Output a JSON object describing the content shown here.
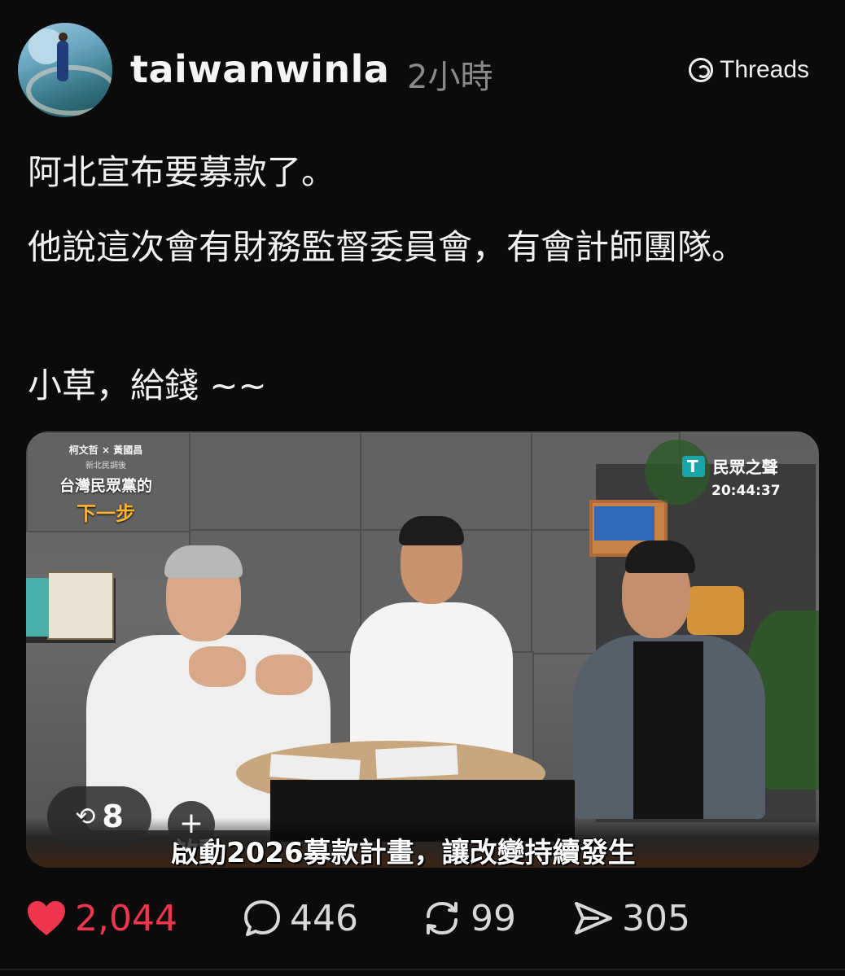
{
  "post": {
    "username": "taiwanwinla",
    "timestamp": "2小時",
    "brand": "Threads",
    "text": {
      "line1": "阿北宣布要募款了。",
      "line2": "他說這次會有財務監督委員會，有會計師團隊。",
      "line3": "小草，給錢 ~~"
    }
  },
  "media": {
    "overlay": {
      "names": "柯文哲 × 黃國昌",
      "subtitle_small": "新北民調後",
      "title": "台灣民眾黨的",
      "step": "下一步"
    },
    "broadcaster": {
      "name": "民眾之聲",
      "time": "20:44:37"
    },
    "caption": "啟動2026募款計畫，讓改變持續發生",
    "repost_count": "8",
    "plus_label": "+"
  },
  "actions": {
    "likes": "2,044",
    "comments": "446",
    "reposts": "99",
    "shares": "305"
  },
  "colors": {
    "background": "#0b0b0b",
    "like": "#f0364f",
    "muted": "#8a8a8a"
  }
}
